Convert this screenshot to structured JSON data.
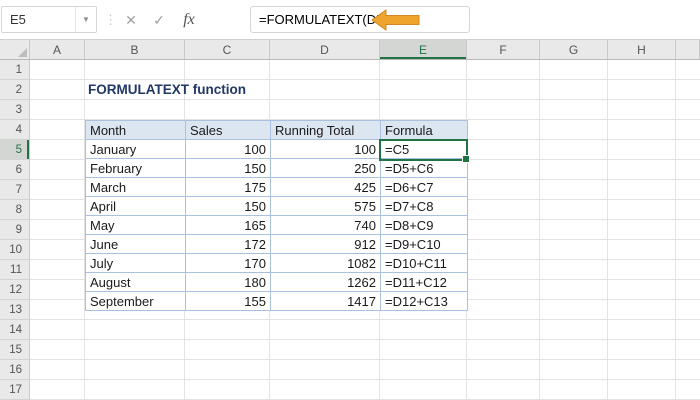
{
  "formula_bar": {
    "name_box": "E5",
    "cancel_icon": "✕",
    "enter_icon": "✓",
    "fx_label": "fx",
    "formula": "=FORMULATEXT(D5)"
  },
  "grid": {
    "column_headers": [
      "A",
      "B",
      "C",
      "D",
      "E",
      "F",
      "G",
      "H"
    ],
    "row_headers": [
      "1",
      "2",
      "3",
      "4",
      "5",
      "6",
      "7",
      "8",
      "9",
      "10",
      "11",
      "12",
      "13",
      "14",
      "15",
      "16",
      "17"
    ],
    "selected_column": "E",
    "selected_row": "5",
    "selected_cell": "E5"
  },
  "sheet": {
    "title": "FORMULATEXT function",
    "table": {
      "headers": [
        "Month",
        "Sales",
        "Running Total",
        "Formula"
      ],
      "rows": [
        [
          "January",
          "100",
          "100",
          "=C5"
        ],
        [
          "February",
          "150",
          "250",
          "=D5+C6"
        ],
        [
          "March",
          "175",
          "425",
          "=D6+C7"
        ],
        [
          "April",
          "150",
          "575",
          "=D7+C8"
        ],
        [
          "May",
          "165",
          "740",
          "=D8+C9"
        ],
        [
          "June",
          "172",
          "912",
          "=D9+C10"
        ],
        [
          "July",
          "170",
          "1082",
          "=D10+C11"
        ],
        [
          "August",
          "180",
          "1262",
          "=D11+C12"
        ],
        [
          "September",
          "155",
          "1417",
          "=D12+C13"
        ]
      ]
    }
  },
  "colors": {
    "selection_green": "#217346",
    "arrow_orange": "#EFA42E",
    "arrow_outline": "#D18A1F",
    "table_header_bg": "#DCE6F1",
    "table_border": "#A9C0DE",
    "title_navy": "#1F3864"
  }
}
